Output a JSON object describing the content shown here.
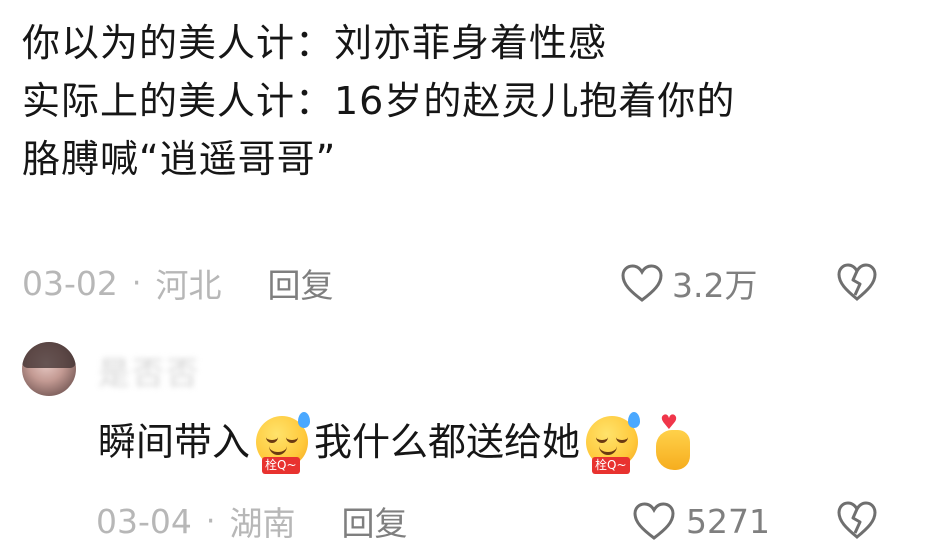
{
  "main_comment": {
    "lines": [
      "你以为的美人计：刘亦菲身着性感",
      "实际上的美人计：16岁的赵灵儿抱着你的",
      "胳膊喊“逍遥哥哥”"
    ],
    "date": "03-02",
    "separator": "·",
    "region": "河北",
    "reply_label": "回复",
    "like_count": "3.2万"
  },
  "reply_comment": {
    "username": "是否否",
    "text_part1": "瞬间带入",
    "text_part2": "我什么都送给她",
    "emoji_tag": "栓Q~",
    "date": "03-04",
    "separator": "·",
    "region": "湖南",
    "reply_label": "回复",
    "like_count": "5271"
  },
  "icons": {
    "like": "heart-outline-icon",
    "dislike": "broken-heart-icon",
    "emoji_sweat": "sweat-smile-emoji",
    "emoji_hand": "finger-heart-emoji"
  },
  "colors": {
    "text_primary": "#161616",
    "text_secondary": "#b7b7b7",
    "text_action": "#7f7f7f"
  }
}
